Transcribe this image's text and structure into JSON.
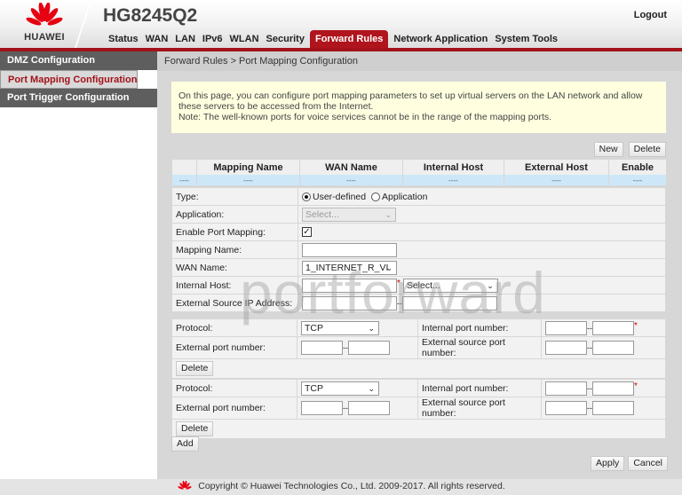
{
  "header": {
    "brand": "HUAWEI",
    "model": "HG8245Q2",
    "logout": "Logout",
    "nav": [
      {
        "label": "Status",
        "active": false
      },
      {
        "label": "WAN",
        "active": false
      },
      {
        "label": "LAN",
        "active": false
      },
      {
        "label": "IPv6",
        "active": false
      },
      {
        "label": "WLAN",
        "active": false
      },
      {
        "label": "Security",
        "active": false
      },
      {
        "label": "Forward Rules",
        "active": true
      },
      {
        "label": "Network Application",
        "active": false
      },
      {
        "label": "System Tools",
        "active": false
      }
    ]
  },
  "sidebar": {
    "items": [
      {
        "label": "DMZ Configuration",
        "selected": false
      },
      {
        "label": "Port Mapping Configuration",
        "selected": true
      },
      {
        "label": "Port Trigger Configuration",
        "selected": false
      }
    ]
  },
  "breadcrumb": "Forward Rules > Port Mapping Configuration",
  "notice": {
    "line1": "On this page, you can configure port mapping parameters to set up virtual servers on the LAN network and allow these servers to be accessed from the Internet.",
    "line2": "Note: The well-known ports for voice services cannot be in the range of the mapping ports."
  },
  "buttons": {
    "new": "New",
    "delete": "Delete",
    "add": "Add",
    "apply": "Apply",
    "cancel": "Cancel",
    "row_delete": "Delete"
  },
  "table": {
    "columns": [
      "",
      "Mapping Name",
      "WAN Name",
      "Internal Host",
      "External Host",
      "Enable"
    ],
    "rows": [
      [
        "----",
        "----",
        "----",
        "----",
        "----",
        "----"
      ]
    ]
  },
  "form": {
    "type_label": "Type:",
    "type_options": [
      "User-defined",
      "Application"
    ],
    "type_selected": "User-defined",
    "application_label": "Application:",
    "application_value": "Select...",
    "enable_label": "Enable Port Mapping:",
    "enable_checked": true,
    "mapping_name_label": "Mapping Name:",
    "mapping_name_value": "",
    "wan_name_label": "WAN Name:",
    "wan_name_value": "1_INTERNET_R_VI",
    "internal_host_label": "Internal Host:",
    "internal_host_value": "",
    "internal_host_select": "Select...",
    "ext_src_ip_label": "External Source IP Address:",
    "ext_src_ip_start": "",
    "ext_src_ip_end": ""
  },
  "port_entries": [
    {
      "protocol_label": "Protocol:",
      "protocol": "TCP",
      "internal_port_label": "Internal port number:",
      "external_port_label": "External port number:",
      "external_source_port_label": "External source port number:"
    },
    {
      "protocol_label": "Protocol:",
      "protocol": "TCP",
      "internal_port_label": "Internal port number:",
      "external_port_label": "External port number:",
      "external_source_port_label": "External source port number:"
    }
  ],
  "watermark": "portforward",
  "footer": "Copyright © Huawei Technologies Co., Ltd. 2009-2017. All rights reserved.",
  "colors": {
    "brand_red": "#a3121a",
    "active_tab": "#b0141d",
    "notice_bg": "#ffffe0",
    "row_highlight": "#cde7f8"
  }
}
